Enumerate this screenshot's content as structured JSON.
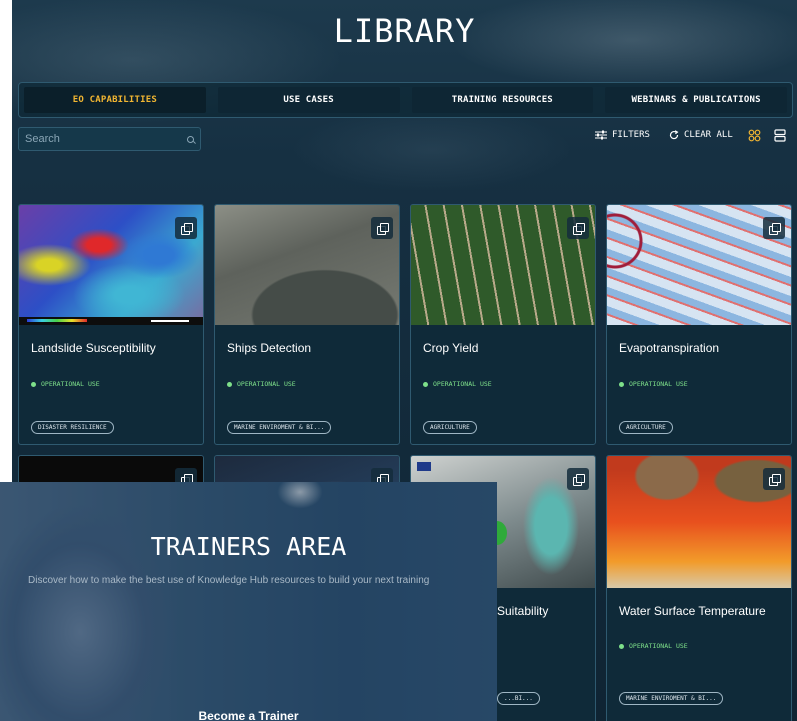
{
  "library": {
    "title": "LIBRARY",
    "tabs": [
      {
        "label": "EO CAPABILITIES",
        "active": true
      },
      {
        "label": "USE CASES",
        "active": false
      },
      {
        "label": "TRAINING RESOURCES",
        "active": false
      },
      {
        "label": "WEBINARS & PUBLICATIONS",
        "active": false
      }
    ],
    "search": {
      "placeholder": "Search"
    },
    "toolbar": {
      "filters": "FILTERS",
      "clear_all": "CLEAR ALL"
    },
    "accent_color": "#f2b632",
    "cards": [
      {
        "title": "Landslide Susceptibility",
        "status": "OPERATIONAL USE",
        "tag": "DISASTER RESILIENCE"
      },
      {
        "title": "Ships Detection",
        "status": "OPERATIONAL USE",
        "tag": "MARINE ENVIROMENT & BI..."
      },
      {
        "title": "Crop Yield",
        "status": "OPERATIONAL USE",
        "tag": "AGRICULTURE"
      },
      {
        "title": "Evapotranspiration",
        "status": "OPERATIONAL USE",
        "tag": "AGRICULTURE"
      },
      {
        "title": "",
        "status": "",
        "tag": ""
      },
      {
        "title": "",
        "status": "",
        "tag": ""
      },
      {
        "title": "Suitability",
        "status": "",
        "tag": "...BI..."
      },
      {
        "title": "Water Surface Temperature",
        "status": "OPERATIONAL USE",
        "tag": "MARINE ENVIROMENT & BI..."
      }
    ]
  },
  "trainers": {
    "title": "TRAINERS AREA",
    "subtitle": "Discover how to make the best use of Knowledge Hub resources to build your next training",
    "link": "Become a Trainer"
  }
}
